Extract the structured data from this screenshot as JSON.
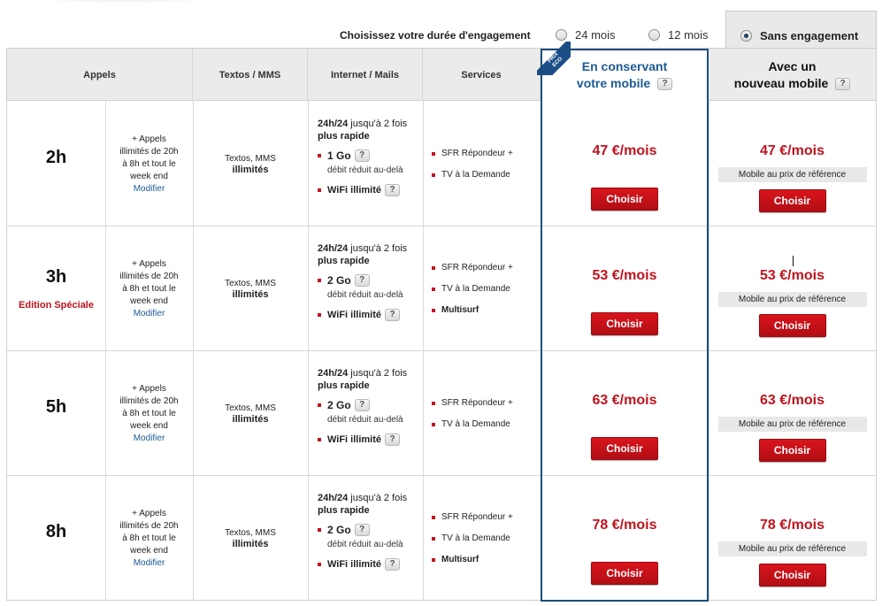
{
  "engagement": {
    "label": "Choisissez votre durée d'engagement",
    "options": [
      {
        "label": "24 mois",
        "selected": false
      },
      {
        "label": "12 mois",
        "selected": false
      },
      {
        "label": "Sans engagement",
        "selected": true
      }
    ]
  },
  "headers": {
    "appels": "Appels",
    "textos": "Textos / MMS",
    "internet": "Internet / Mails",
    "services": "Services",
    "eco_badge_line1": "PRIX",
    "eco_badge_line2": "ECO",
    "eco_line1": "En conservant",
    "eco_line2": "votre mobile",
    "new_line1": "Avec un",
    "new_line2": "nouveau mobile",
    "help": "?"
  },
  "rows": [
    {
      "hours": "2h",
      "subtitle": "",
      "calls_lines": [
        "+ Appels",
        "illimités de 20h",
        "à 8h et tout le",
        "week end"
      ],
      "modify": "Modifier",
      "sms_line1": "Textos, MMS",
      "sms_line2": "illimités",
      "internet_title": "24h/24",
      "internet_title_rest": " jusqu'à 2 fois",
      "internet_title2": "plus rapide",
      "data": "1 Go",
      "data_note": "débit réduit au-delà",
      "wifi": "WiFi illimité",
      "services": [
        "SFR Répondeur +",
        "TV à la Demande"
      ],
      "services_bold": "",
      "price_eco": "47 €/mois",
      "price_new": "47 €/mois",
      "mobile_ref": "Mobile au prix de référence",
      "choose": "Choisir"
    },
    {
      "hours": "3h",
      "subtitle": "Edition Spéciale",
      "calls_lines": [
        "+ Appels",
        "illimités de 20h",
        "à 8h et tout le",
        "week end"
      ],
      "modify": "Modifier",
      "sms_line1": "Textos, MMS",
      "sms_line2": "illimités",
      "internet_title": "24h/24",
      "internet_title_rest": " jusqu'à 2 fois",
      "internet_title2": "plus rapide",
      "data": "2 Go",
      "data_note": "débit réduit au-delà",
      "wifi": "WiFi illimité",
      "services": [
        "SFR Répondeur +",
        "TV à la Demande"
      ],
      "services_bold": "Multisurf",
      "price_eco": "53 €/mois",
      "price_new": "53 €/mois",
      "mobile_ref": "Mobile au prix de référence",
      "choose": "Choisir"
    },
    {
      "hours": "5h",
      "subtitle": "",
      "calls_lines": [
        "+ Appels",
        "illimités de 20h",
        "à 8h et tout le",
        "week end"
      ],
      "modify": "Modifier",
      "sms_line1": "Textos, MMS",
      "sms_line2": "illimités",
      "internet_title": "24h/24",
      "internet_title_rest": " jusqu'à 2 fois",
      "internet_title2": "plus rapide",
      "data": "2 Go",
      "data_note": "débit réduit au-delà",
      "wifi": "WiFi illimité",
      "services": [
        "SFR Répondeur +",
        "TV à la Demande"
      ],
      "services_bold": "",
      "price_eco": "63 €/mois",
      "price_new": "63 €/mois",
      "mobile_ref": "Mobile au prix de référence",
      "choose": "Choisir"
    },
    {
      "hours": "8h",
      "subtitle": "",
      "calls_lines": [
        "+ Appels",
        "illimités de 20h",
        "à 8h et tout le",
        "week end"
      ],
      "modify": "Modifier",
      "sms_line1": "Textos, MMS",
      "sms_line2": "illimités",
      "internet_title": "24h/24",
      "internet_title_rest": " jusqu'à 2 fois",
      "internet_title2": "plus rapide",
      "data": "2 Go",
      "data_note": "débit réduit au-delà",
      "wifi": "WiFi illimité",
      "services": [
        "SFR Répondeur +",
        "TV à la Demande"
      ],
      "services_bold": "Multisurf",
      "price_eco": "78 €/mois",
      "price_new": "78 €/mois",
      "mobile_ref": "Mobile au prix de référence",
      "choose": "Choisir"
    }
  ]
}
